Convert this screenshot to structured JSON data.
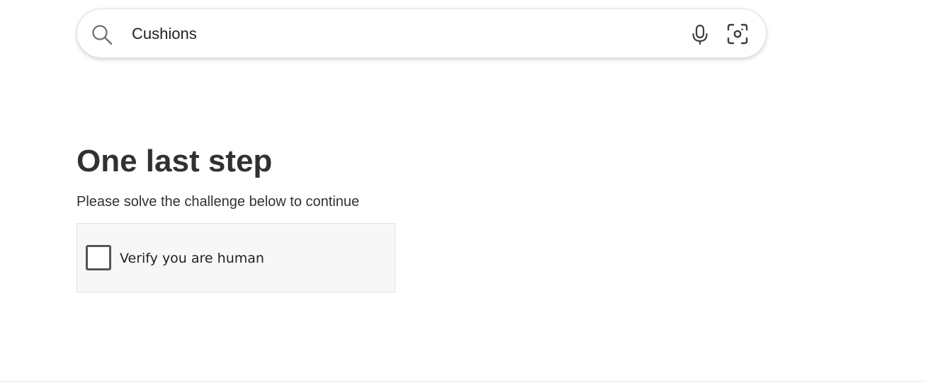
{
  "search": {
    "value": "Cushions",
    "icons": {
      "search": "search-icon",
      "voice": "microphone-icon",
      "image_search": "lens-icon"
    }
  },
  "challenge": {
    "title": "One last step",
    "subtitle": "Please solve the challenge below to continue",
    "checkbox_label": "Verify you are human",
    "checked": false
  },
  "colors": {
    "text_dark": "#313131",
    "box_background": "#f7f7f7",
    "checkbox_border": "#555555",
    "icon_gray": "#5f6368"
  }
}
